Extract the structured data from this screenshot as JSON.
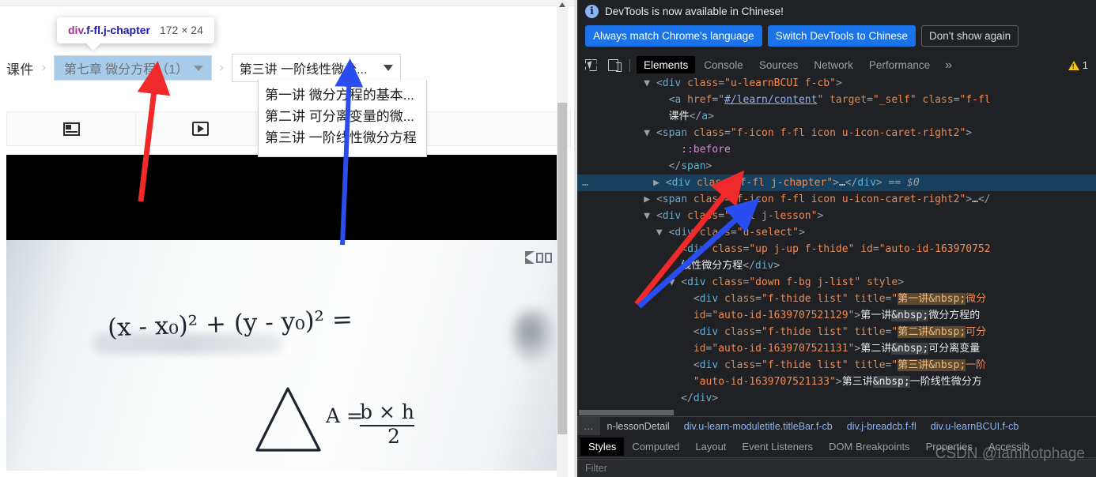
{
  "webpage": {
    "breadcrumb": {
      "root_label": "课件",
      "separator": "›",
      "chapter_label": "第七章 微分方程（1）",
      "lesson_label": "第三讲 一阶线性微分..."
    },
    "inspector_tooltip": {
      "tag": "div",
      "classes": ".f-fl.j-chapter",
      "dimensions": "172 × 24"
    },
    "lesson_dropdown": {
      "options": [
        "第一讲 微分方程的基本...",
        "第二讲 可分离变量的微...",
        "第三讲 一阶线性微分方程"
      ]
    },
    "content_tabs": [
      {
        "icon": "slide-icon",
        "active": false
      },
      {
        "icon": "play-icon",
        "active": false
      },
      {
        "icon": "play-icon",
        "active": true
      }
    ],
    "whiteboard": {
      "formula_1": "(x - x₀)² + (y - y₀)² =",
      "formula_2_label": "A =",
      "formula_2_num": "b × h",
      "formula_2_den": "2"
    }
  },
  "devtools": {
    "banner": {
      "icon": "info-icon",
      "message": "DevTools is now available in Chinese!",
      "buttons": [
        "Always match Chrome's language",
        "Switch DevTools to Chinese",
        "Don't show again"
      ]
    },
    "toolbar": {
      "icons": [
        "inspect-element-icon",
        "device-toolbar-icon"
      ],
      "tabs": [
        "Elements",
        "Console",
        "Sources",
        "Network",
        "Performance"
      ],
      "active_tab": "Elements",
      "overflow_label": "»",
      "warning_count": "1"
    },
    "dom_tree": [
      {
        "indent": 5,
        "twisty": "▼",
        "parts": [
          {
            "t": "pun",
            "s": "<"
          },
          {
            "t": "tag",
            "s": "div"
          },
          {
            "t": "pun",
            "s": " "
          },
          {
            "t": "attrn",
            "s": "class"
          },
          {
            "t": "pun",
            "s": "="
          },
          {
            "t": "val",
            "s": "\"u-learnBCUI f-cb\""
          },
          {
            "t": "pun",
            "s": ">"
          }
        ]
      },
      {
        "indent": 6,
        "twisty": "",
        "parts": [
          {
            "t": "pun",
            "s": "<"
          },
          {
            "t": "tag",
            "s": "a"
          },
          {
            "t": "pun",
            "s": " "
          },
          {
            "t": "attrn",
            "s": "href"
          },
          {
            "t": "pun",
            "s": "="
          },
          {
            "t": "pun",
            "s": "\""
          },
          {
            "t": "lnk",
            "s": "#/learn/content"
          },
          {
            "t": "pun",
            "s": "\""
          },
          {
            "t": "pun",
            "s": " "
          },
          {
            "t": "attrn",
            "s": "target"
          },
          {
            "t": "pun",
            "s": "="
          },
          {
            "t": "val",
            "s": "\"_self\""
          },
          {
            "t": "pun",
            "s": " "
          },
          {
            "t": "attrn",
            "s": "class"
          },
          {
            "t": "pun",
            "s": "="
          },
          {
            "t": "val",
            "s": "\"f-fl "
          }
        ]
      },
      {
        "indent": 6,
        "twisty": "",
        "parts": [
          {
            "t": "txt",
            "s": "课件"
          },
          {
            "t": "pun",
            "s": "</"
          },
          {
            "t": "tag",
            "s": "a"
          },
          {
            "t": "pun",
            "s": ">"
          }
        ]
      },
      {
        "indent": 5,
        "twisty": "▼",
        "parts": [
          {
            "t": "pun",
            "s": "<"
          },
          {
            "t": "tag",
            "s": "span"
          },
          {
            "t": "pun",
            "s": " "
          },
          {
            "t": "attrn",
            "s": "class"
          },
          {
            "t": "pun",
            "s": "="
          },
          {
            "t": "val",
            "s": "\"f-icon f-fl icon u-icon-caret-right2\""
          },
          {
            "t": "pun",
            "s": ">"
          }
        ]
      },
      {
        "indent": 7,
        "twisty": "",
        "parts": [
          {
            "t": "pseudo",
            "s": "::before"
          }
        ]
      },
      {
        "indent": 6,
        "twisty": "",
        "parts": [
          {
            "t": "pun",
            "s": "</"
          },
          {
            "t": "tag",
            "s": "span"
          },
          {
            "t": "pun",
            "s": ">"
          }
        ]
      },
      {
        "indent": 5,
        "twisty": "▶",
        "selected": true,
        "parts": [
          {
            "t": "pun",
            "s": "<"
          },
          {
            "t": "tag",
            "s": "div"
          },
          {
            "t": "pun",
            "s": " "
          },
          {
            "t": "attrn",
            "s": "class"
          },
          {
            "t": "pun",
            "s": "="
          },
          {
            "t": "val",
            "s": "\"f-fl j-chapter\""
          },
          {
            "t": "pun",
            "s": ">"
          },
          {
            "t": "txt",
            "s": "…"
          },
          {
            "t": "pun",
            "s": "</"
          },
          {
            "t": "tag",
            "s": "div"
          },
          {
            "t": "pun",
            "s": "> == "
          },
          {
            "t": "dollar",
            "s": "$0"
          }
        ]
      },
      {
        "indent": 5,
        "twisty": "▶",
        "parts": [
          {
            "t": "pun",
            "s": "<"
          },
          {
            "t": "tag",
            "s": "span"
          },
          {
            "t": "pun",
            "s": " "
          },
          {
            "t": "attrn",
            "s": "class"
          },
          {
            "t": "pun",
            "s": "="
          },
          {
            "t": "val",
            "s": "\"f-icon f-fl icon u-icon-caret-right2\""
          },
          {
            "t": "pun",
            "s": ">"
          },
          {
            "t": "txt",
            "s": "…"
          },
          {
            "t": "pun",
            "s": "</"
          }
        ]
      },
      {
        "indent": 5,
        "twisty": "▼",
        "parts": [
          {
            "t": "pun",
            "s": "<"
          },
          {
            "t": "tag",
            "s": "div"
          },
          {
            "t": "pun",
            "s": " "
          },
          {
            "t": "attrn",
            "s": "class"
          },
          {
            "t": "pun",
            "s": "="
          },
          {
            "t": "val",
            "s": "\"f-fl j-lesson\""
          },
          {
            "t": "pun",
            "s": ">"
          }
        ]
      },
      {
        "indent": 6,
        "twisty": "▼",
        "parts": [
          {
            "t": "pun",
            "s": "<"
          },
          {
            "t": "tag",
            "s": "div"
          },
          {
            "t": "pun",
            "s": " "
          },
          {
            "t": "attrn",
            "s": "class"
          },
          {
            "t": "pun",
            "s": "="
          },
          {
            "t": "val",
            "s": "\"u-select\""
          },
          {
            "t": "pun",
            "s": ">"
          }
        ]
      },
      {
        "indent": 7,
        "twisty": "",
        "parts": [
          {
            "t": "pun",
            "s": "<"
          },
          {
            "t": "tag",
            "s": "div"
          },
          {
            "t": "pun",
            "s": " "
          },
          {
            "t": "attrn",
            "s": "class"
          },
          {
            "t": "pun",
            "s": "="
          },
          {
            "t": "val",
            "s": "\"up j-up f-thide\""
          },
          {
            "t": "pun",
            "s": " "
          },
          {
            "t": "attrn",
            "s": "id"
          },
          {
            "t": "pun",
            "s": "="
          },
          {
            "t": "val",
            "s": "\"auto-id-163970752"
          }
        ]
      },
      {
        "indent": 7,
        "twisty": "",
        "parts": [
          {
            "t": "txt",
            "s": "线性微分方程"
          },
          {
            "t": "pun",
            "s": "</"
          },
          {
            "t": "tag",
            "s": "div"
          },
          {
            "t": "pun",
            "s": ">"
          }
        ]
      },
      {
        "indent": 7,
        "twisty": "▼",
        "parts": [
          {
            "t": "pun",
            "s": "<"
          },
          {
            "t": "tag",
            "s": "div"
          },
          {
            "t": "pun",
            "s": " "
          },
          {
            "t": "attrn",
            "s": "class"
          },
          {
            "t": "pun",
            "s": "="
          },
          {
            "t": "val",
            "s": "\"down f-bg j-list\""
          },
          {
            "t": "pun",
            "s": " "
          },
          {
            "t": "attrn",
            "s": "style"
          },
          {
            "t": "pun",
            "s": ">"
          }
        ]
      },
      {
        "indent": 8,
        "twisty": "",
        "parts": [
          {
            "t": "pun",
            "s": "<"
          },
          {
            "t": "tag",
            "s": "div"
          },
          {
            "t": "pun",
            "s": " "
          },
          {
            "t": "attrn",
            "s": "class"
          },
          {
            "t": "pun",
            "s": "="
          },
          {
            "t": "val",
            "s": "\"f-thide list\""
          },
          {
            "t": "pun",
            "s": " "
          },
          {
            "t": "attrn",
            "s": "title"
          },
          {
            "t": "pun",
            "s": "="
          },
          {
            "t": "val",
            "s": "\""
          },
          {
            "t": "hl",
            "s": "第一讲&nbsp;"
          },
          {
            "t": "val",
            "s": "微分"
          }
        ]
      },
      {
        "indent": 8,
        "twisty": "",
        "parts": [
          {
            "t": "attrn",
            "s": "id"
          },
          {
            "t": "pun",
            "s": "="
          },
          {
            "t": "val",
            "s": "\"auto-id-1639707521129\""
          },
          {
            "t": "pun",
            "s": ">"
          },
          {
            "t": "txt",
            "s": "第一讲"
          },
          {
            "t": "sel-txt-hl",
            "s": "&nbsp;"
          },
          {
            "t": "txt",
            "s": "微分方程的"
          }
        ]
      },
      {
        "indent": 8,
        "twisty": "",
        "parts": [
          {
            "t": "pun",
            "s": "<"
          },
          {
            "t": "tag",
            "s": "div"
          },
          {
            "t": "pun",
            "s": " "
          },
          {
            "t": "attrn",
            "s": "class"
          },
          {
            "t": "pun",
            "s": "="
          },
          {
            "t": "val",
            "s": "\"f-thide list\""
          },
          {
            "t": "pun",
            "s": " "
          },
          {
            "t": "attrn",
            "s": "title"
          },
          {
            "t": "pun",
            "s": "="
          },
          {
            "t": "val",
            "s": "\""
          },
          {
            "t": "hl",
            "s": "第二讲&nbsp;"
          },
          {
            "t": "val",
            "s": "可分"
          }
        ]
      },
      {
        "indent": 8,
        "twisty": "",
        "parts": [
          {
            "t": "attrn",
            "s": "id"
          },
          {
            "t": "pun",
            "s": "="
          },
          {
            "t": "val",
            "s": "\"auto-id-1639707521131\""
          },
          {
            "t": "pun",
            "s": ">"
          },
          {
            "t": "txt",
            "s": "第二讲"
          },
          {
            "t": "sel-txt-hl",
            "s": "&nbsp;"
          },
          {
            "t": "txt",
            "s": "可分离变量"
          }
        ]
      },
      {
        "indent": 8,
        "twisty": "",
        "parts": [
          {
            "t": "pun",
            "s": "<"
          },
          {
            "t": "tag",
            "s": "div"
          },
          {
            "t": "pun",
            "s": " "
          },
          {
            "t": "attrn",
            "s": "class"
          },
          {
            "t": "pun",
            "s": "="
          },
          {
            "t": "val",
            "s": "\"f-thide list\""
          },
          {
            "t": "pun",
            "s": " "
          },
          {
            "t": "attrn",
            "s": "title"
          },
          {
            "t": "pun",
            "s": "="
          },
          {
            "t": "val",
            "s": "\""
          },
          {
            "t": "hl",
            "s": "第三讲&nbsp;"
          },
          {
            "t": "val",
            "s": "一阶"
          }
        ]
      },
      {
        "indent": 8,
        "twisty": "",
        "parts": [
          {
            "t": "val",
            "s": "\"auto-id-1639707521133\""
          },
          {
            "t": "pun",
            "s": ">"
          },
          {
            "t": "txt",
            "s": "第三讲"
          },
          {
            "t": "sel-txt-hl",
            "s": "&nbsp;"
          },
          {
            "t": "txt",
            "s": "一阶线性微分方"
          }
        ]
      },
      {
        "indent": 7,
        "twisty": "",
        "parts": [
          {
            "t": "pun",
            "s": "</"
          },
          {
            "t": "tag",
            "s": "div"
          },
          {
            "t": "pun",
            "s": ">"
          }
        ]
      },
      {
        "indent": 7,
        "twisty": "",
        "parts": [
          {
            "t": "pun",
            "s": "‹‹‹"
          }
        ]
      }
    ],
    "dom_crumbs": {
      "ellipsis": "…",
      "items": [
        "n-lessonDetail",
        "div.u-learn-moduletitle.titleBar.f-cb",
        "div.j-breadcb.f-fl",
        "div.u-learnBCUI.f-cb"
      ]
    },
    "bottom_tabs": [
      "Styles",
      "Computed",
      "Layout",
      "Event Listeners",
      "DOM Breakpoints",
      "Properties",
      "Accessib"
    ],
    "bottom_active_tab": "Styles",
    "filter_placeholder": "Filter"
  },
  "watermark": "CSDN @Iamnotphage",
  "annotations": {
    "arrow_red_color": "#f02a2a",
    "arrow_blue_color": "#2a4df0"
  },
  "colors": {
    "accent_green": "#0ec87e",
    "breadcrumb_highlight": "#a8cdeb",
    "devtools_bg": "#202124",
    "devtools_blue": "#1a73e8",
    "selected_row": "#17405e"
  }
}
